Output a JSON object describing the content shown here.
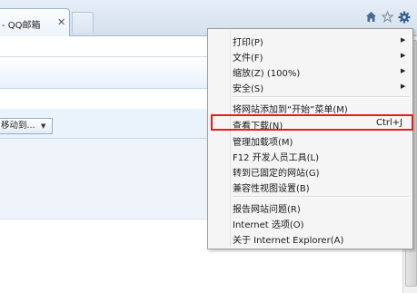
{
  "browser": {
    "tab": {
      "title": "- QQ邮箱",
      "close_glyph": "✕"
    },
    "icons": {
      "home": "home-icon",
      "favorites": "star-icon",
      "tools": "gear-icon"
    }
  },
  "page": {
    "move_to_button": "移动到...",
    "move_to_arrow": "▼"
  },
  "tools_menu": {
    "items": [
      {
        "label": "打印(P)",
        "shortcut": "",
        "submenu": "▶"
      },
      {
        "label": "文件(F)",
        "shortcut": "",
        "submenu": "▶"
      },
      {
        "label": "缩放(Z) (100%)",
        "shortcut": "",
        "submenu": "▶"
      },
      {
        "label": "安全(S)",
        "shortcut": "",
        "submenu": "▶"
      },
      {
        "label": "将网站添加到“开始”菜单(M)",
        "shortcut": "",
        "submenu": ""
      },
      {
        "label": "查看下载(N)",
        "shortcut": "Ctrl+J",
        "submenu": ""
      },
      {
        "label": "管理加载项(M)",
        "shortcut": "",
        "submenu": ""
      },
      {
        "label": "F12 开发人员工具(L)",
        "shortcut": "",
        "submenu": ""
      },
      {
        "label": "转到已固定的网站(G)",
        "shortcut": "",
        "submenu": ""
      },
      {
        "label": "兼容性视图设置(B)",
        "shortcut": "",
        "submenu": ""
      },
      {
        "label": "报告网站问题(R)",
        "shortcut": "",
        "submenu": ""
      },
      {
        "label": "Internet 选项(O)",
        "shortcut": "",
        "submenu": ""
      },
      {
        "label": "关于 Internet Explorer(A)",
        "shortcut": "",
        "submenu": ""
      }
    ],
    "highlighted_item": "查看下载(N)"
  },
  "colors": {
    "highlight_border": "#e21e1e",
    "menu_background": "#f5f5f5",
    "tools_icon": "#375e90"
  }
}
